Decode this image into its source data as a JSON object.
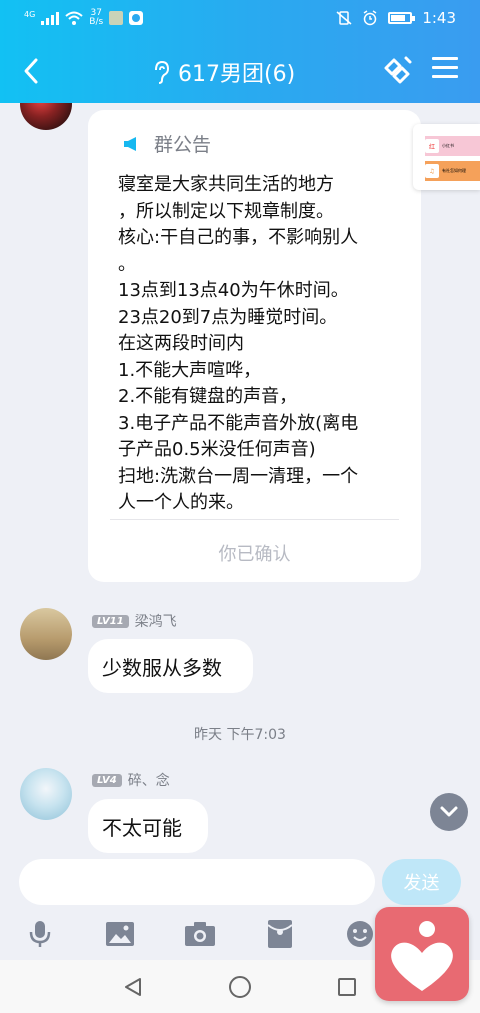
{
  "status_bar": {
    "network": "4G",
    "speed_value": "37",
    "speed_unit": "B/s",
    "time": "1:43"
  },
  "header": {
    "title": "617男团(6)"
  },
  "announcement": {
    "heading": "群公告",
    "body": "寝室是大家共同生活的地方\n，所以制定以下规章制度。\n核心:干自己的事，不影响别人\n。\n13点到13点40为午休时间。\n23点20到7点为睡觉时间。\n在这两段时间内\n1.不能大声喧哗，\n2.不能有键盘的声音，\n3.电子产品不能声音外放(离电\n子产品0.5米没任何声音)\n扫地:洗漱台一周一清理，一个\n人一个人的来。",
    "confirm_label": "你已确认"
  },
  "side_card": {
    "item1": "小红书",
    "item2": "有社怎如何理"
  },
  "messages": [
    {
      "level": "LV11",
      "sender": "梁鸿飞",
      "text": "少数服从多数"
    },
    {
      "level": "LV4",
      "sender": "碎、念",
      "text": "不太可能"
    }
  ],
  "timestamp": "昨天 下午7:03",
  "input": {
    "value": "",
    "send_label": "发送"
  },
  "colors": {
    "header_start": "#12c1f3",
    "header_end": "#3a9cf0",
    "background": "#eef0f6",
    "send_button": "#bfe7f8",
    "float_widget": "#e86a72"
  },
  "toolbar_icons": [
    "microphone-icon",
    "image-icon",
    "camera-icon",
    "red-packet-icon",
    "emoji-icon"
  ],
  "nav_icons": [
    "back-triangle-icon",
    "home-circle-icon",
    "recents-square-icon"
  ]
}
